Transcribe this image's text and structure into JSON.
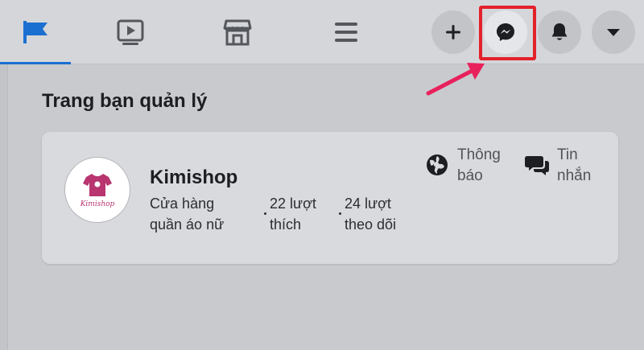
{
  "header": {
    "nav_tabs": [
      {
        "name": "pages-flag-icon",
        "active": true
      },
      {
        "name": "watch-icon",
        "active": false
      },
      {
        "name": "marketplace-icon",
        "active": false
      },
      {
        "name": "menu-icon",
        "active": false
      }
    ],
    "actions": [
      "create-plus-icon",
      "messenger-icon",
      "notifications-bell-icon",
      "account-caret-icon"
    ],
    "highlight_color": "#e3212a",
    "accent_color": "#1b6fd1"
  },
  "section": {
    "title": "Trang bạn quản lý"
  },
  "page_card": {
    "name": "Kimishop",
    "avatar_text": "Kimishop",
    "category_line1": "Cửa hàng",
    "category_line2": "quần áo nữ",
    "likes_line1": "22 lượt",
    "likes_line2": "thích",
    "follows_line1": "24 lượt",
    "follows_line2": "theo dõi",
    "action_notify_line1": "Thông",
    "action_notify_line2": "báo",
    "action_message_line1": "Tin",
    "action_message_line2": "nhắn"
  }
}
